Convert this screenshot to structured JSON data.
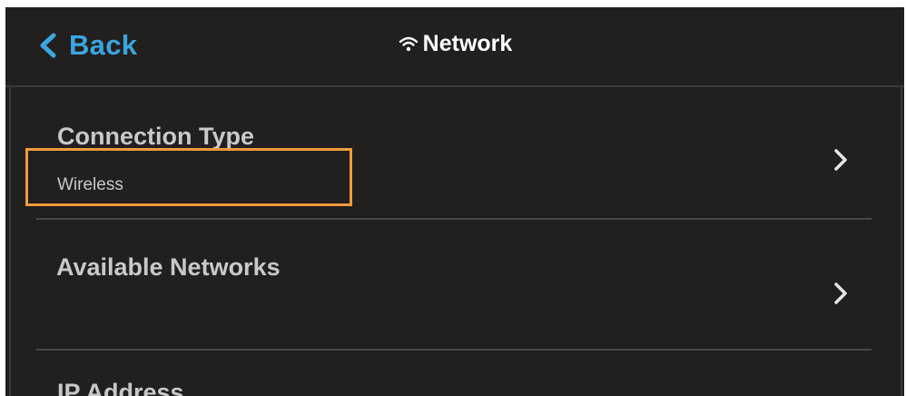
{
  "header": {
    "back_label": "Back",
    "title": "Network",
    "title_icon": "wifi-icon",
    "back_icon": "chevron-left-icon"
  },
  "settings": [
    {
      "title": "Connection Type",
      "value": "Wireless",
      "icon": "chevron-right-icon"
    },
    {
      "title": "Available Networks",
      "value": "",
      "icon": "chevron-right-icon",
      "highlighted": true
    },
    {
      "title": "IP Address",
      "value": ""
    }
  ],
  "colors": {
    "background": "#221f1f",
    "accent": "#3aa6e0",
    "text": "#c9c9c9",
    "highlight": "#f19c3a",
    "divider": "#4a4747"
  }
}
